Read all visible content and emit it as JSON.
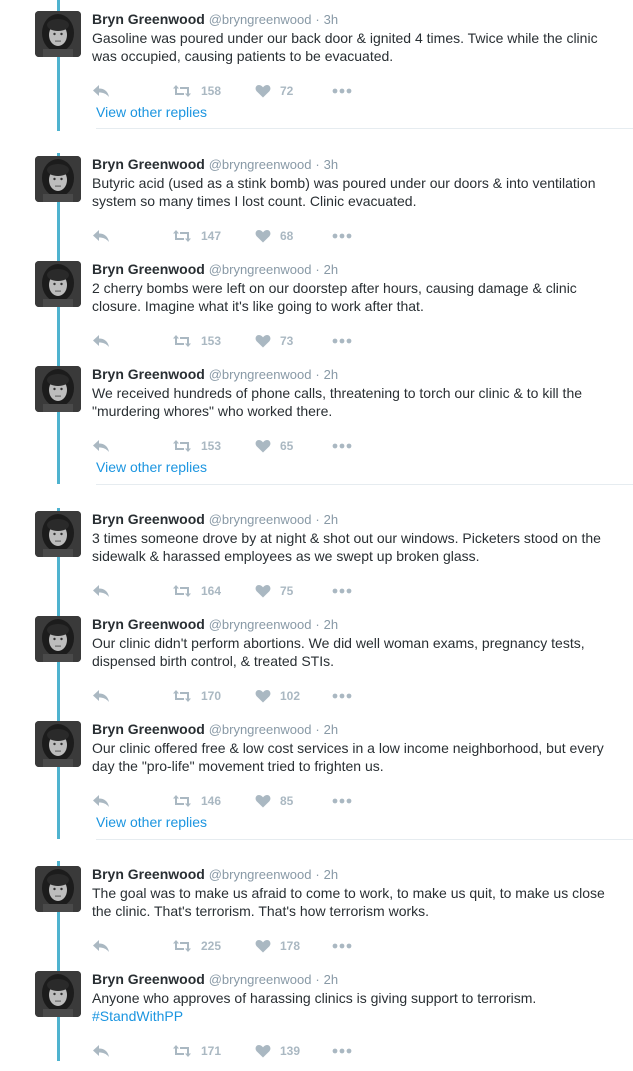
{
  "author": {
    "name": "Bryn Greenwood",
    "handle": "@bryngreenwood",
    "separator": "·"
  },
  "view_other_replies_label": "View other replies",
  "tweets": [
    {
      "time": "3h",
      "text": "Gasoline was poured under our back door & ignited 4 times. Twice while the clinic was occupied, causing patients to be evacuated.",
      "retweets": "158",
      "likes": "72"
    },
    {
      "time": "3h",
      "text": "Butyric acid (used as a stink bomb) was poured under our doors & into ventilation system so many times I lost count. Clinic evacuated.",
      "retweets": "147",
      "likes": "68"
    },
    {
      "time": "2h",
      "text": "2 cherry bombs were left on our doorstep after hours, causing damage & clinic closure. Imagine what it's like going to work after that.",
      "retweets": "153",
      "likes": "73"
    },
    {
      "time": "2h",
      "text": "We received hundreds of phone calls, threatening to torch our clinic & to kill the \"murdering whores\" who worked there.",
      "retweets": "153",
      "likes": "65"
    },
    {
      "time": "2h",
      "text": "3 times someone drove by at night & shot out our windows. Picketers stood on the sidewalk & harassed employees as we swept up broken glass.",
      "retweets": "164",
      "likes": "75"
    },
    {
      "time": "2h",
      "text": "Our clinic didn't perform abortions. We did well woman exams, pregnancy tests, dispensed birth control, & treated STIs.",
      "retweets": "170",
      "likes": "102"
    },
    {
      "time": "2h",
      "text": "Our clinic offered free & low cost services in a low income neighborhood, but every day the \"pro-life\" movement tried to frighten us.",
      "retweets": "146",
      "likes": "85"
    },
    {
      "time": "2h",
      "text": "The goal was to make us afraid to come to work, to make us quit, to make us close the clinic. That's terrorism. That's how terrorism works.",
      "retweets": "225",
      "likes": "178"
    },
    {
      "time": "2h",
      "text": "Anyone who approves of harassing clinics is giving support to terrorism.",
      "hashtag": "#StandWithPP",
      "retweets": "171",
      "likes": "139"
    }
  ],
  "icons": {
    "reply": "reply-icon",
    "retweet": "retweet-icon",
    "like": "heart-icon",
    "more": "more-icon"
  },
  "colors": {
    "link": "#1b95e0",
    "thread_line": "#4fb3cf",
    "muted": "#8899a6",
    "action": "#aab8c2"
  }
}
